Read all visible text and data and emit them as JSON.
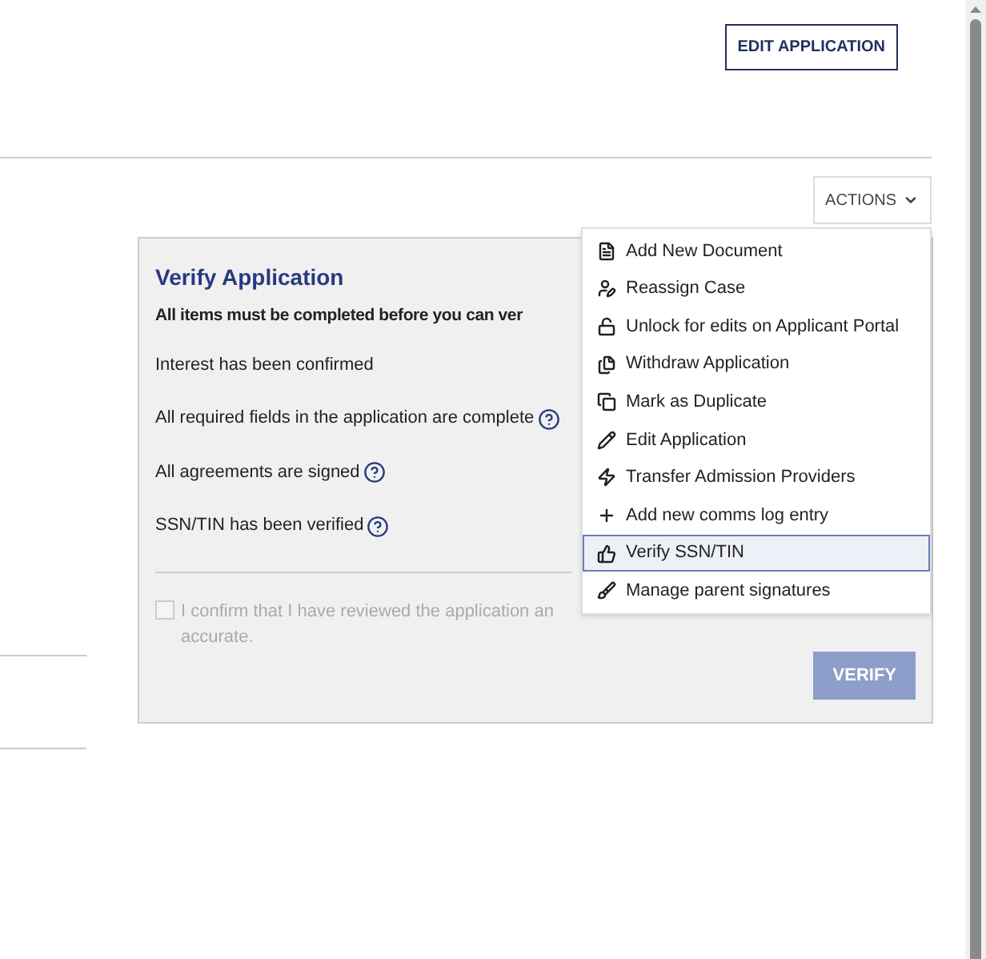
{
  "header": {
    "edit_button": "EDIT APPLICATION"
  },
  "actions": {
    "label": "ACTIONS",
    "items": [
      {
        "label": "Add New Document",
        "selected": false
      },
      {
        "label": "Reassign Case",
        "selected": false
      },
      {
        "label": "Unlock for edits on Applicant Portal",
        "selected": false
      },
      {
        "label": "Withdraw Application",
        "selected": false
      },
      {
        "label": "Mark as Duplicate",
        "selected": false
      },
      {
        "label": "Edit Application",
        "selected": false
      },
      {
        "label": "Transfer Admission Providers",
        "selected": false
      },
      {
        "label": "Add new comms log entry",
        "selected": false
      },
      {
        "label": "Verify SSN/TIN",
        "selected": true
      },
      {
        "label": "Manage parent signatures",
        "selected": false
      }
    ]
  },
  "card": {
    "title": "Verify Application",
    "instruction": "All items must be completed before you can ver",
    "items": [
      {
        "label": "Interest has been confirmed",
        "help": false
      },
      {
        "label": "All required fields in the application are complete",
        "help": true
      },
      {
        "label": "All agreements are signed",
        "help": true
      },
      {
        "label": "SSN/TIN has been verified",
        "help": true
      }
    ],
    "confirm": {
      "line_1": "I confirm that I have reviewed the application an",
      "line_2": "accurate.",
      "checked": false,
      "disabled": true
    },
    "verify_button": {
      "label": "VERIFY",
      "disabled": true
    }
  }
}
